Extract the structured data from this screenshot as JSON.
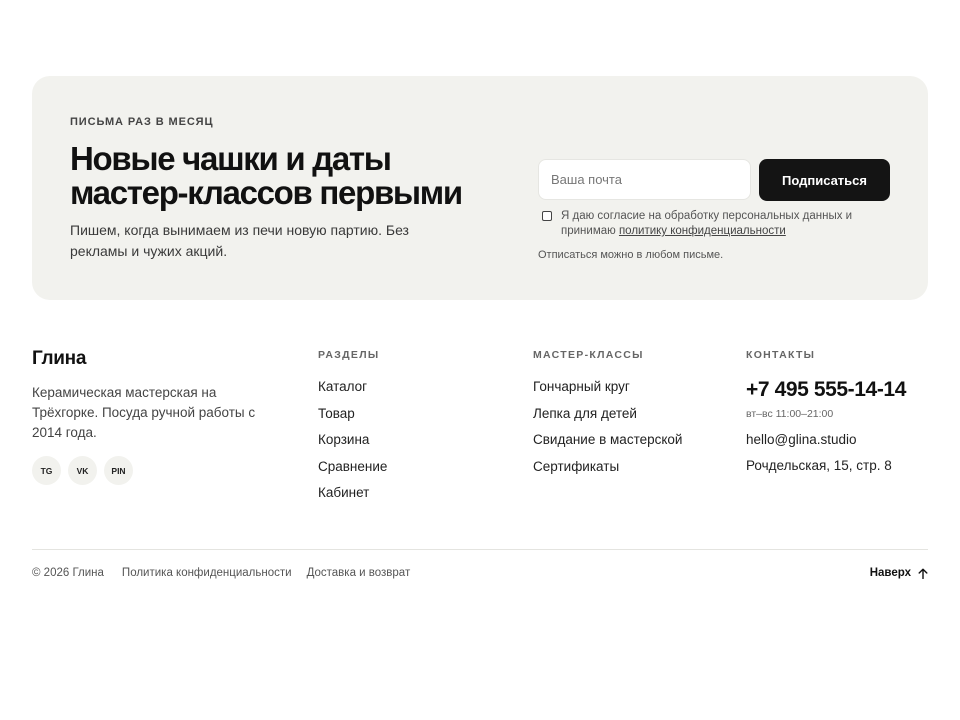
{
  "newsletter": {
    "eyebrow": "ПИСЬМА РАЗ В МЕСЯЦ",
    "headline": "Новые чашки и даты мастер-классов первыми",
    "description": "Пишем, когда вынимаем из печи новую партию. Без рекламы и чужих акций.",
    "email_placeholder": "Ваша почта",
    "email_value": "",
    "subscribe_label": "Подписаться",
    "consent_text": "Я даю согласие на обработку персональных данных и принимаю",
    "consent_link": "политику конфиденциальности",
    "consent_checked": false,
    "unsubscribe_note": "Отписаться можно в любом письме."
  },
  "brand": {
    "name": "Глина",
    "description": "Керамическая мастерская на Трёхгорке. Посуда ручной работы с 2014 года.",
    "socials": [
      "TG",
      "VK",
      "PIN"
    ]
  },
  "columns": {
    "sections": {
      "title": "РАЗДЕЛЫ",
      "items": [
        "Каталог",
        "Товар",
        "Корзина",
        "Сравнение",
        "Кабинет"
      ]
    },
    "classes": {
      "title": "МАСТЕР-КЛАССЫ",
      "items": [
        "Гончарный круг",
        "Лепка для детей",
        "Свидание в мастерской",
        "Сертификаты"
      ]
    },
    "contacts": {
      "title": "КОНТАКТЫ",
      "phone": "+7 495 555-14-14",
      "hours": "вт–вс 11:00–21:00",
      "email": "hello@glina.studio",
      "address": "Рочдельская, 15, стр. 8"
    }
  },
  "bottom": {
    "copyright": "© 2026 Глина",
    "privacy": "Политика конфиденциальности",
    "delivery": "Доставка и возврат",
    "to_top": "Наверх"
  },
  "colors": {
    "card_bg": "#f2f2ee",
    "button_bg": "#141414",
    "text": "#1a1a1a"
  },
  "icons": {
    "to_top": "arrow-up-icon"
  }
}
